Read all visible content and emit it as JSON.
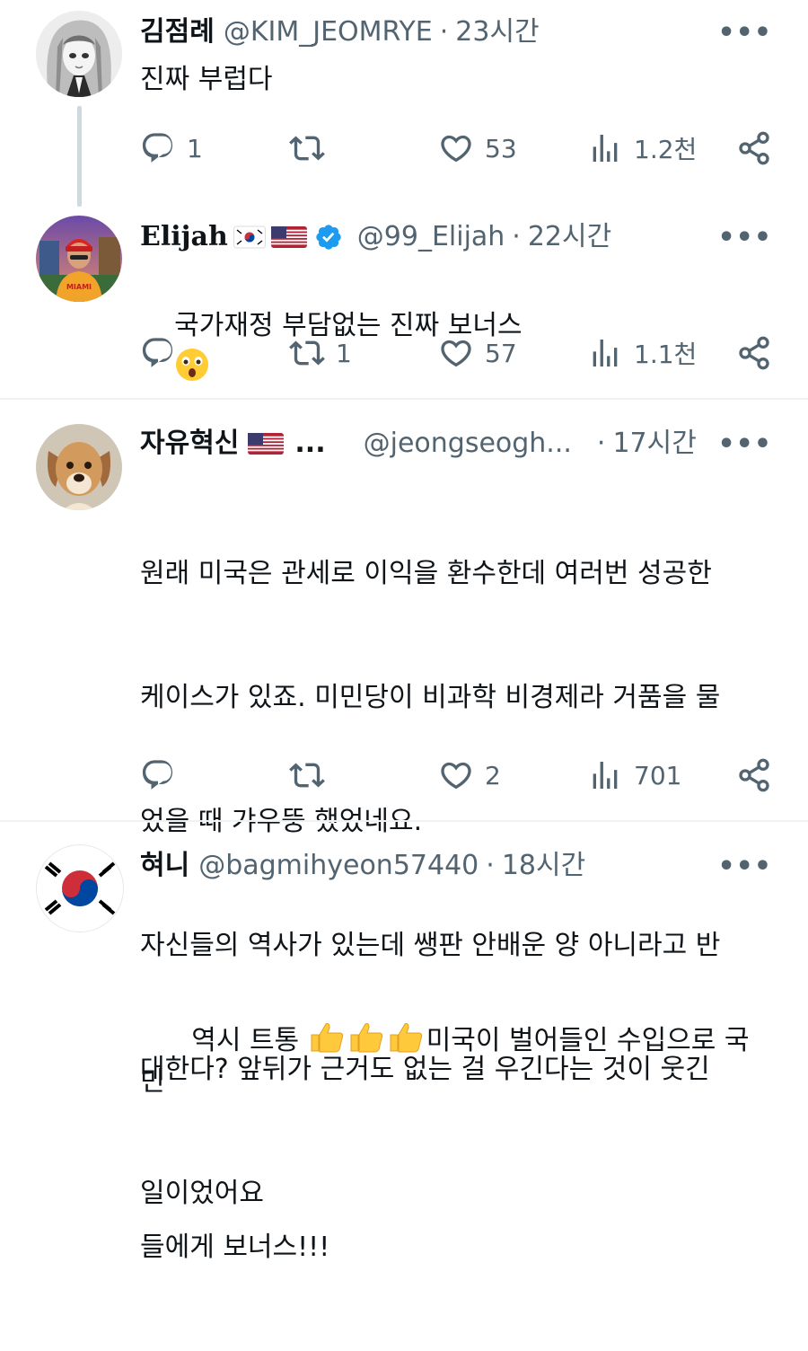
{
  "tweets": [
    {
      "name": "김점례",
      "handle": "@KIM_JEOMRYE",
      "dot": "·",
      "time": "23시간",
      "text": "진짜 부럽다",
      "replies": "1",
      "retweets": "",
      "likes": "53",
      "views": "1.2천"
    },
    {
      "name": "Elijah",
      "handle": "@99_Elijah",
      "dot": "·",
      "time": "22시간",
      "text": "국가재정 부담없는 진짜 보너스",
      "replies": "",
      "retweets": "1",
      "likes": "57",
      "views": "1.1천"
    },
    {
      "name": "자유혁신",
      "name_ellipsis": "...",
      "handle": "@jeongseogh...",
      "dot": "·",
      "time": "17시간",
      "text_lines": [
        "원래 미국은 관세로 이익을 환수한데 여러번 성공한",
        "케이스가 있죠. 미민당이 비과학 비경제라 거품을 물",
        "었을 때 갸우뚱 했었네요.",
        "자신들의 역사가 있는데 쌩판 안배운 양 아니라고 반",
        "대한다? 앞뒤가 근거도 없는 걸 우긴다는 것이 웃긴",
        "일이었어요"
      ],
      "replies": "",
      "retweets": "",
      "likes": "2",
      "views": "701"
    },
    {
      "name": "혀니",
      "handle": "@bagmihyeon57440",
      "dot": "·",
      "time": "18시간",
      "text_a": "역시 트통 ",
      "text_b": "미국이 벌어들인 수입으로 국민",
      "text_c": "들에게 보너스!!!"
    }
  ],
  "more_label": "•••",
  "icons": {
    "reply": "reply-icon",
    "retweet": "retweet-icon",
    "like": "heart-icon",
    "views": "views-icon",
    "share": "share-icon",
    "verified": "verified-badge-icon",
    "flag_kr": "korea-flag-icon",
    "flag_us": "usa-flag-icon"
  },
  "colors": {
    "text": "#0f1419",
    "secondary": "#536471",
    "verified": "#1d9bf0",
    "divider": "#eff3f4"
  }
}
